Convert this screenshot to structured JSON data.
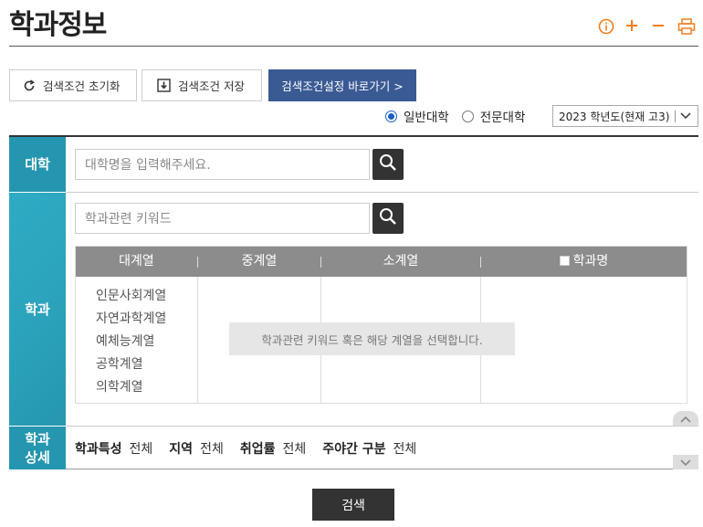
{
  "page": {
    "title": "학과정보"
  },
  "top_icons": [
    "info-icon",
    "plus-icon",
    "minus-icon",
    "print-icon"
  ],
  "toolbar": {
    "reset_label": "검색조건 초기화",
    "save_label": "검색조건 저장",
    "goto_label": "검색조건설정 바로가기 >"
  },
  "radio": {
    "options": [
      {
        "label": "일반대학",
        "selected": true
      },
      {
        "label": "전문대학",
        "selected": false
      }
    ]
  },
  "year_select": {
    "value": "2023 학년도(현재 고3)"
  },
  "university": {
    "label": "대학",
    "placeholder": "대학명을 입력해주세요."
  },
  "major": {
    "label": "학과",
    "placeholder": "학과관련 키워드",
    "headers": [
      "대계열",
      "중계열",
      "소계열",
      "학과명"
    ],
    "categories": [
      "인문사회계열",
      "자연과학계열",
      "예체능계열",
      "공학계열",
      "의학계열"
    ],
    "hint": "학과관련 키워드 혹은 해당 계열을 선택합니다."
  },
  "detail": {
    "label_line1": "학과",
    "label_line2": "상세",
    "filters": [
      {
        "name": "학과특성",
        "value": "전체"
      },
      {
        "name": "지역",
        "value": "전체"
      },
      {
        "name": "취업률",
        "value": "전체"
      },
      {
        "name": "주야간 구분",
        "value": "전체"
      }
    ]
  },
  "search_button": "검색",
  "colors": {
    "accent": "#f07d1d",
    "label_bg": "#2a9fb8",
    "primary_btn": "#3a5a94",
    "dark": "#333333"
  }
}
